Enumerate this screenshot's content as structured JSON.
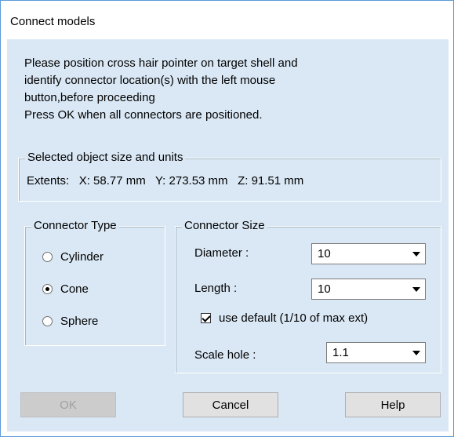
{
  "window": {
    "title": "Connect models"
  },
  "instructions": [
    "Please position cross hair pointer on target shell and",
    "identify connector location(s) with the left mouse",
    "button,before proceeding",
    "Press OK when all connectors are positioned."
  ],
  "selected_object": {
    "legend": "Selected object size and units",
    "extents_label": "Extents:",
    "x": "X: 58.77 mm",
    "y": "Y: 273.53 mm",
    "z": "Z: 91.51 mm"
  },
  "connector_type": {
    "legend": "Connector Type",
    "options": [
      {
        "label": "Cylinder",
        "checked": false
      },
      {
        "label": "Cone",
        "checked": true
      },
      {
        "label": "Sphere",
        "checked": false
      }
    ]
  },
  "connector_size": {
    "legend": "Connector Size",
    "diameter_label": "Diameter :",
    "diameter_value": "10",
    "length_label": "Length :",
    "length_value": "10",
    "use_default_label": "use default (1/10 of max ext)",
    "use_default_checked": true,
    "scale_hole_label": "Scale hole :",
    "scale_hole_value": "1.1"
  },
  "buttons": {
    "ok": "OK",
    "cancel": "Cancel",
    "help": "Help"
  }
}
